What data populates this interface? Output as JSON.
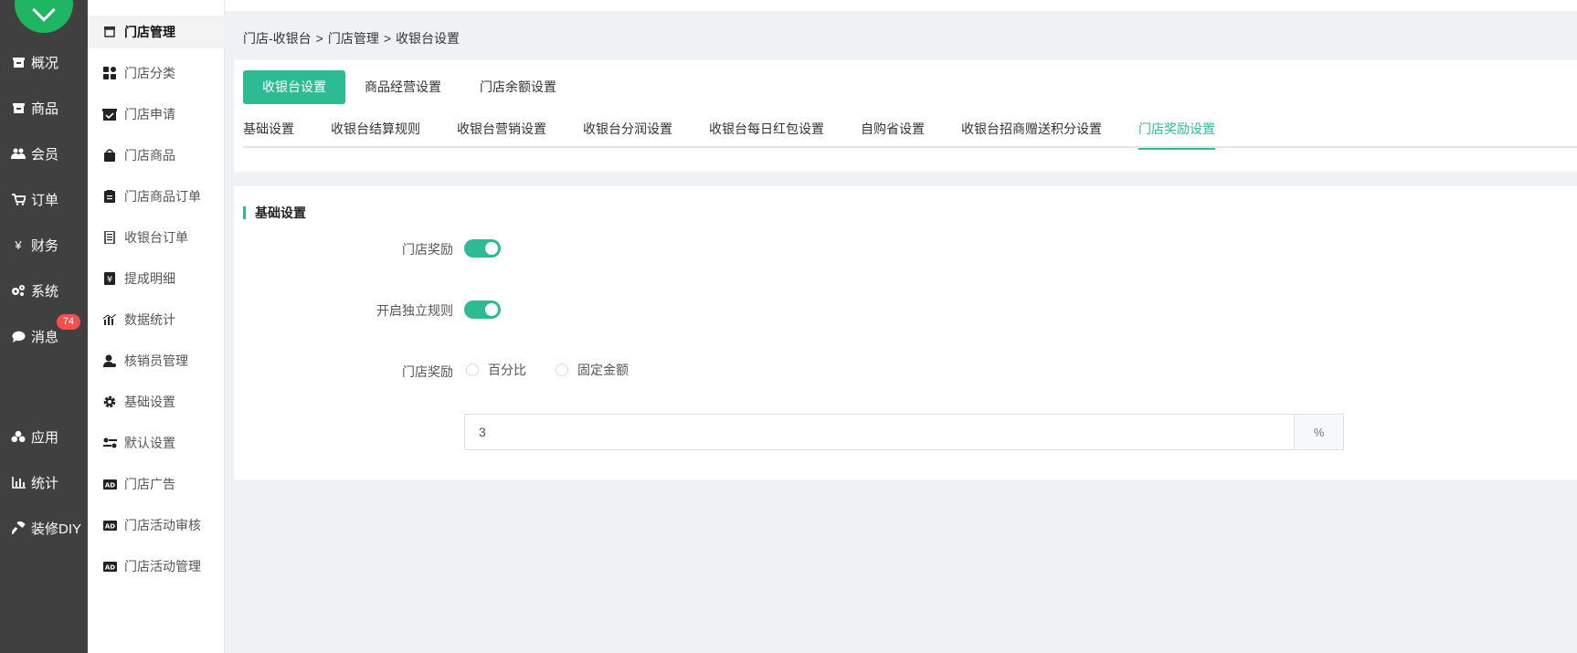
{
  "left_nav": {
    "items": [
      {
        "label": "概况",
        "icon": "store-icon"
      },
      {
        "label": "商品",
        "icon": "store-icon"
      },
      {
        "label": "会员",
        "icon": "users-icon"
      },
      {
        "label": "订单",
        "icon": "cart-icon"
      },
      {
        "label": "财务",
        "icon": "yen-icon"
      },
      {
        "label": "系统",
        "icon": "gears-icon"
      },
      {
        "label": "消息",
        "icon": "chat-icon"
      },
      {
        "label": "应用",
        "icon": "cubes-icon"
      },
      {
        "label": "统计",
        "icon": "bar-chart-icon"
      },
      {
        "label": "装修DIY",
        "icon": "hammer-icon"
      }
    ],
    "message_badge": "74"
  },
  "sub_nav": {
    "items": [
      {
        "label": "门店管理",
        "icon": "store-icon",
        "active": true
      },
      {
        "label": "门店分类",
        "icon": "category-icon"
      },
      {
        "label": "门店申请",
        "icon": "inbox-check-icon"
      },
      {
        "label": "门店商品",
        "icon": "bag-icon"
      },
      {
        "label": "门店商品订单",
        "icon": "clipboard-icon"
      },
      {
        "label": "收银台订单",
        "icon": "receipt-icon"
      },
      {
        "label": "提成明细",
        "icon": "yen-doc-icon"
      },
      {
        "label": "数据统计",
        "icon": "stats-icon"
      },
      {
        "label": "核销员管理",
        "icon": "user-gear-icon"
      },
      {
        "label": "基础设置",
        "icon": "gear-icon"
      },
      {
        "label": "默认设置",
        "icon": "sliders-icon"
      },
      {
        "label": "门店广告",
        "icon": "ad-icon"
      },
      {
        "label": "门店活动审核",
        "icon": "ad-icon"
      },
      {
        "label": "门店活动管理",
        "icon": "ad-icon"
      }
    ]
  },
  "breadcrumb": [
    "门店-收银台",
    "门店管理",
    "收银台设置"
  ],
  "breadcrumb_sep": ">",
  "pill_tabs": [
    "收银台设置",
    "商品经营设置",
    "门店余额设置"
  ],
  "line_tabs": [
    "基础设置",
    "收银台结算规则",
    "收银台营销设置",
    "收银台分润设置",
    "收银台每日红包设置",
    "自购省设置",
    "收银台招商赠送积分设置",
    "门店奖励设置"
  ],
  "settings": {
    "section_title": "基础设置",
    "store_reward_label": "门店奖励",
    "store_reward_enabled": true,
    "independent_rule_label": "开启独立规则",
    "independent_rule_enabled": true,
    "reward_type_label": "门店奖励",
    "reward_type_options": [
      "百分比",
      "固定金额"
    ],
    "reward_value": "3",
    "reward_suffix": "%"
  },
  "colors": {
    "accent": "#2dbb93",
    "left_nav_bg": "#404040",
    "badge": "#f5504f",
    "logo": "#1fb563"
  }
}
